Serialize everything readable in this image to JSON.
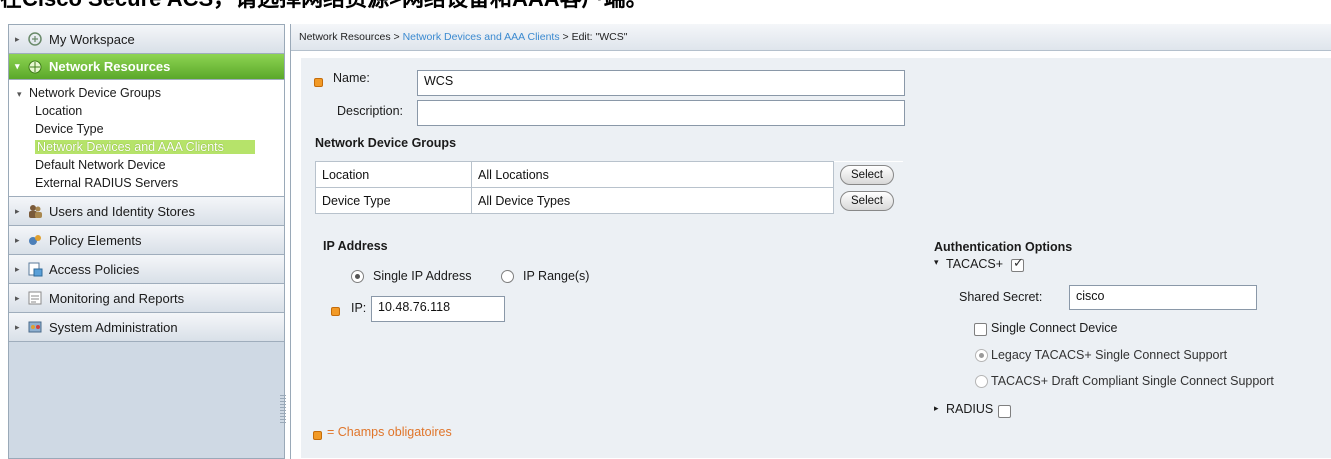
{
  "caption": "在Cisco Secure ACS，请选择网络资源>网络设备和AAA客户端。",
  "sidebar": {
    "items": [
      {
        "label": "My Workspace",
        "icon": "workspace-icon"
      },
      {
        "label": "Network Resources",
        "icon": "network-resources-icon",
        "active": true
      },
      {
        "label": "Users and Identity Stores",
        "icon": "users-icon"
      },
      {
        "label": "Policy Elements",
        "icon": "policy-elements-icon"
      },
      {
        "label": "Access Policies",
        "icon": "access-policies-icon"
      },
      {
        "label": "Monitoring and Reports",
        "icon": "monitoring-icon"
      },
      {
        "label": "System Administration",
        "icon": "system-admin-icon"
      }
    ],
    "subtree": {
      "group": "Network Device Groups",
      "children": [
        "Location",
        "Device Type"
      ],
      "selected": "Network Devices and AAA Clients",
      "others": [
        "Default Network Device",
        "External RADIUS Servers"
      ]
    }
  },
  "breadcrumb": {
    "root": "Network Resources >",
    "link": "Network Devices and AAA Clients",
    "tail": "> Edit: \"WCS\""
  },
  "form": {
    "name_label": "Name:",
    "name_value": "WCS",
    "description_label": "Description:",
    "description_value": "",
    "ndg_heading": "Network Device Groups",
    "ndg_rows": [
      {
        "label": "Location",
        "value": "All Locations",
        "button": "Select"
      },
      {
        "label": "Device Type",
        "value": "All Device Types",
        "button": "Select"
      }
    ],
    "ip_heading": "IP Address",
    "radio_single": "Single IP Address",
    "radio_range": "IP Range(s)",
    "ip_label": "IP:",
    "ip_value": "10.48.76.118",
    "required_note": "= Champs obligatoires"
  },
  "auth": {
    "heading": "Authentication Options",
    "tacacs_label": "TACACS+",
    "tacacs_checked": true,
    "shared_secret_label": "Shared Secret:",
    "shared_secret_value": "cisco",
    "single_connect_label": "Single Connect Device",
    "legacy_label": "Legacy TACACS+ Single Connect Support",
    "draft_label": "TACACS+ Draft Compliant Single Connect Support",
    "radius_label": "RADIUS",
    "radius_checked": false
  },
  "colors": {
    "accent_green": "#5aa82a",
    "link_blue": "#3b8ad0",
    "required_orange": "#f29a26"
  }
}
